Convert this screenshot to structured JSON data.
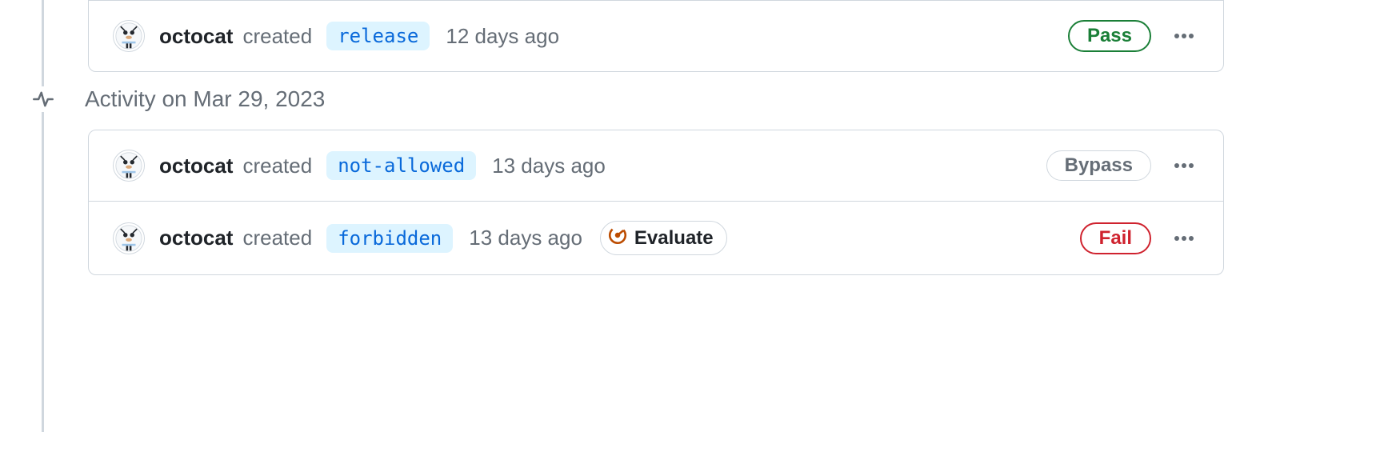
{
  "section": {
    "date_heading": "Activity on Mar 29, 2023"
  },
  "top_group": {
    "rows": [
      {
        "user": "octocat",
        "action": "created",
        "tag": "release",
        "time": "12 days ago",
        "status": {
          "label": "Pass",
          "variant": "pass"
        }
      }
    ]
  },
  "bottom_group": {
    "rows": [
      {
        "user": "octocat",
        "action": "created",
        "tag": "not-allowed",
        "time": "13 days ago",
        "status": {
          "label": "Bypass",
          "variant": "bypass"
        }
      },
      {
        "user": "octocat",
        "action": "created",
        "tag": "forbidden",
        "time": "13 days ago",
        "evaluate": "Evaluate",
        "status": {
          "label": "Fail",
          "variant": "fail"
        }
      }
    ]
  },
  "icons": {
    "pulse": "pulse-icon",
    "kebab": "kebab-icon",
    "gauge": "gauge-icon",
    "avatar": "octocat-avatar"
  }
}
